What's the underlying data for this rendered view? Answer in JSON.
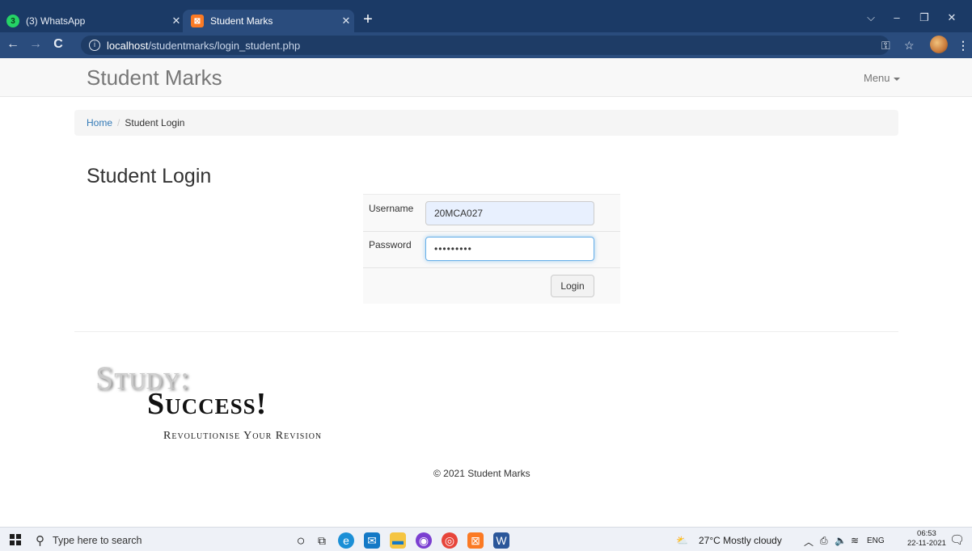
{
  "browser": {
    "tabs": [
      {
        "label": "(3) WhatsApp",
        "favicon": "whatsapp-icon",
        "badge": "3"
      },
      {
        "label": "Student Marks",
        "favicon": "xampp-icon",
        "active": true
      }
    ],
    "url_host": "localhost",
    "url_path": "/studentmarks/login_student.php",
    "accent": "#1b3a66"
  },
  "navbar": {
    "brand": "Student Marks",
    "menu_label": "Menu"
  },
  "breadcrumb": {
    "home": "Home",
    "separator": "/",
    "current": "Student Login"
  },
  "page": {
    "heading": "Student Login"
  },
  "login_form": {
    "username_label": "Username",
    "username_value": "20MCA027",
    "password_label": "Password",
    "password_value": "•••••••••",
    "submit_label": "Login"
  },
  "logo": {
    "line1": "Study:",
    "line2": "Success!",
    "tagline": "Revolutionise Your Revision"
  },
  "footer": {
    "copyright": "© 2021 Student Marks"
  },
  "taskbar": {
    "search_placeholder": "Type here to search",
    "weather": "27°C  Mostly cloudy",
    "language": "ENG",
    "time": "06:53",
    "date": "22-11-2021"
  }
}
